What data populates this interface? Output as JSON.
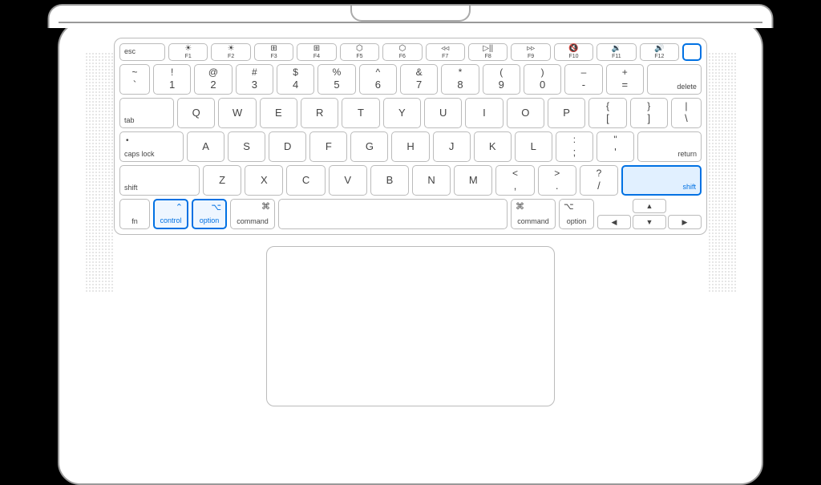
{
  "fn_row": {
    "esc": "esc",
    "keys": [
      {
        "glyph": "☀",
        "label": "F1"
      },
      {
        "glyph": "☀",
        "label": "F2"
      },
      {
        "glyph": "⊞",
        "label": "F3"
      },
      {
        "glyph": "⊞",
        "label": "F4"
      },
      {
        "glyph": "⬡",
        "label": "F5"
      },
      {
        "glyph": "⬡",
        "label": "F6"
      },
      {
        "glyph": "◃◃",
        "label": "F7"
      },
      {
        "glyph": "▷||",
        "label": "F8"
      },
      {
        "glyph": "▹▹",
        "label": "F9"
      },
      {
        "glyph": "🔇",
        "label": "F10"
      },
      {
        "glyph": "🔉",
        "label": "F11"
      },
      {
        "glyph": "🔊",
        "label": "F12"
      }
    ]
  },
  "number_row": {
    "tilde": {
      "upper": "~",
      "lower": "`"
    },
    "keys": [
      {
        "upper": "!",
        "lower": "1"
      },
      {
        "upper": "@",
        "lower": "2"
      },
      {
        "upper": "#",
        "lower": "3"
      },
      {
        "upper": "$",
        "lower": "4"
      },
      {
        "upper": "%",
        "lower": "5"
      },
      {
        "upper": "^",
        "lower": "6"
      },
      {
        "upper": "&",
        "lower": "7"
      },
      {
        "upper": "*",
        "lower": "8"
      },
      {
        "upper": "(",
        "lower": "9"
      },
      {
        "upper": ")",
        "lower": "0"
      },
      {
        "upper": "–",
        "lower": "-"
      },
      {
        "upper": "+",
        "lower": "="
      }
    ],
    "delete": "delete"
  },
  "qwerty_row": {
    "tab": "tab",
    "keys": [
      "Q",
      "W",
      "E",
      "R",
      "T",
      "Y",
      "U",
      "I",
      "O",
      "P"
    ],
    "lbracket": {
      "upper": "{",
      "lower": "["
    },
    "rbracket": {
      "upper": "}",
      "lower": "]"
    },
    "bslash": {
      "upper": "|",
      "lower": "\\"
    }
  },
  "home_row": {
    "caps": "caps lock",
    "keys": [
      "A",
      "S",
      "D",
      "F",
      "G",
      "H",
      "J",
      "K",
      "L"
    ],
    "semi": {
      "upper": ":",
      "lower": ";"
    },
    "quote": {
      "upper": "\"",
      "lower": "'"
    },
    "return": "return"
  },
  "shift_row": {
    "lshift": "shift",
    "keys": [
      "Z",
      "X",
      "C",
      "V",
      "B",
      "N",
      "M"
    ],
    "comma": {
      "upper": "<",
      "lower": ","
    },
    "period": {
      "upper": ">",
      "lower": "."
    },
    "slash": {
      "upper": "?",
      "lower": "/"
    },
    "rshift": "shift"
  },
  "mod_row": {
    "fn": "fn",
    "control": {
      "glyph": "⌃",
      "label": "control"
    },
    "loption": {
      "glyph": "⌥",
      "label": "option"
    },
    "lcommand": {
      "glyph": "⌘",
      "label": "command"
    },
    "rcommand": {
      "glyph": "⌘",
      "label": "command"
    },
    "roption": {
      "glyph": "⌥",
      "label": "option"
    },
    "arrows": {
      "up": "▲",
      "down": "▼",
      "left": "◀",
      "right": "▶"
    }
  },
  "highlighted_keys": [
    "power-button",
    "control-key",
    "left-option-key",
    "right-shift-key"
  ]
}
